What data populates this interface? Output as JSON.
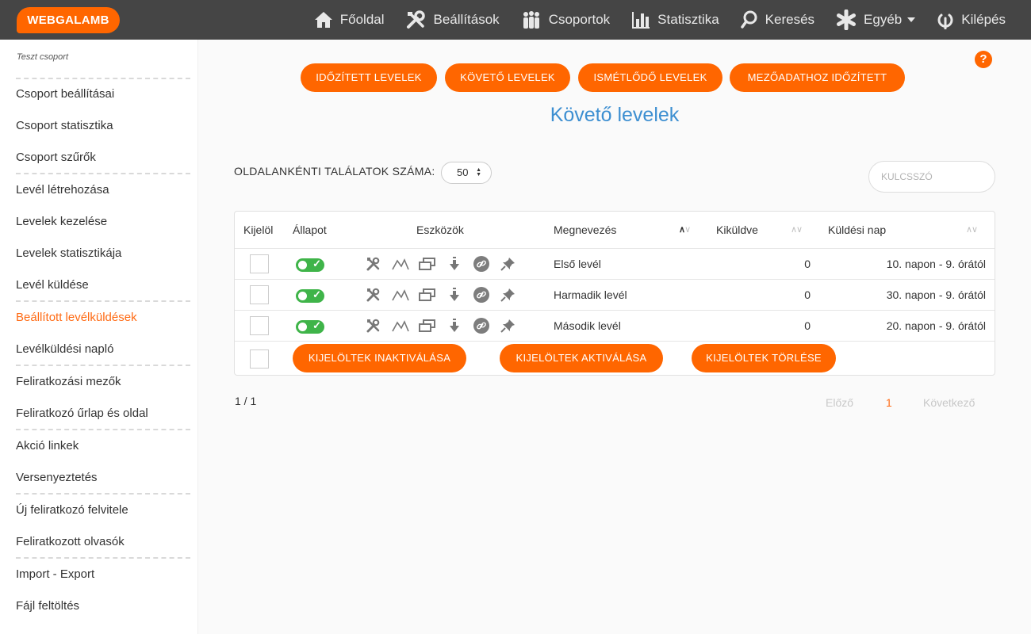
{
  "brand": {
    "logo_text": "WEBGALAMB",
    "accent": "#ff6600",
    "link_color": "#3d8fd1",
    "toggle_on": "#3fb449"
  },
  "nav": [
    {
      "label": "Főoldal",
      "icon": "home-icon"
    },
    {
      "label": "Beállítások",
      "icon": "tools-icon"
    },
    {
      "label": "Csoportok",
      "icon": "people-icon"
    },
    {
      "label": "Statisztika",
      "icon": "bar-chart-icon"
    },
    {
      "label": "Keresés",
      "icon": "search-icon"
    },
    {
      "label": "Egyéb",
      "icon": "asterisk-icon"
    },
    {
      "label": "Kilépés",
      "icon": "power-icon"
    }
  ],
  "sidebar": {
    "group_name": "Teszt csoport",
    "items": [
      {
        "label": "Csoport beállításai"
      },
      {
        "label": "Csoport statisztika"
      },
      {
        "label": "Csoport szűrők"
      },
      {
        "label": "Levél létrehozása"
      },
      {
        "label": "Levelek kezelése"
      },
      {
        "label": "Levelek statisztikája"
      },
      {
        "label": "Levél küldése"
      },
      {
        "label": "Beállított levélküldések",
        "active": true
      },
      {
        "label": "Levélküldési napló"
      },
      {
        "label": "Feliratkozási mezők"
      },
      {
        "label": "Feliratkozó űrlap és oldal"
      },
      {
        "label": "Akció linkek"
      },
      {
        "label": "Versenyeztetés"
      },
      {
        "label": "Új feliratkozó felvitele"
      },
      {
        "label": "Feliratkozott olvasók"
      },
      {
        "label": "Import - Export"
      },
      {
        "label": "Fájl feltöltés"
      }
    ]
  },
  "tabs": [
    {
      "label": "IDŐZÍTETT LEVELEK"
    },
    {
      "label": "KÖVETŐ LEVELEK"
    },
    {
      "label": "ISMÉTLŐDŐ LEVELEK"
    },
    {
      "label": "MEZŐADATHOZ IDŐZÍTETT"
    }
  ],
  "page_title": "Követő levelek",
  "per_page": {
    "label": "OLDALANKÉNTI TALÁLATOK SZÁMA:",
    "value": "50"
  },
  "search": {
    "placeholder": "KULCSSZÓ"
  },
  "table": {
    "headers": {
      "select": "Kijelöl",
      "status": "Állapot",
      "tools": "Eszközök",
      "name": "Megnevezés",
      "sent": "Kiküldve",
      "send_day": "Küldési nap"
    },
    "tool_icons": [
      "settings-tools-icon",
      "statistics-line-icon",
      "copy-icon",
      "download-icon",
      "link-icon",
      "pin-icon"
    ],
    "rows": [
      {
        "name": "Első levél",
        "sent": "0",
        "send_day": "10. napon - 9. órától",
        "active": true
      },
      {
        "name": "Harmadik levél",
        "sent": "0",
        "send_day": "30. napon - 9. órától",
        "active": true
      },
      {
        "name": "Második levél",
        "sent": "0",
        "send_day": "20. napon - 9. órától",
        "active": true
      }
    ],
    "bulk_actions": {
      "deactivate": "KIJELÖLTEK INAKTIVÁLÁSA",
      "activate": "KIJELÖLTEK AKTIVÁLÁSA",
      "delete": "KIJELÖLTEK TÖRLÉSE"
    }
  },
  "pagination": {
    "count": "1 / 1",
    "prev": "Előző",
    "current": "1",
    "next": "Következő"
  }
}
